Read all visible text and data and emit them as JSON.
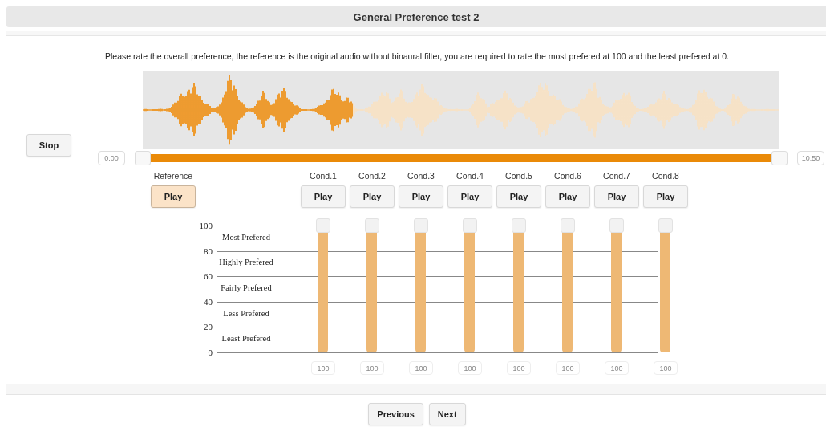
{
  "header": {
    "title": "General Preference test 2"
  },
  "instruction": "Please rate the overall preference, the reference is the original audio without binaural filter, you are required to rate the most prefered at 100 and the least prefered at 0.",
  "stop_button": "Stop",
  "waveform": {
    "level": 0.33
  },
  "range": {
    "start_time": "0.00",
    "end_time": "10.50",
    "start": {
      "level": 0
    },
    "end": {
      "level": 1
    }
  },
  "reference": {
    "label": "Reference",
    "button": "Play",
    "selected": true
  },
  "conditions": [
    {
      "label": "Cond.1",
      "button": "Play",
      "selected": false,
      "level": 1,
      "value": "100"
    },
    {
      "label": "Cond.2",
      "button": "Play",
      "selected": false,
      "level": 1,
      "value": "100"
    },
    {
      "label": "Cond.3",
      "button": "Play",
      "selected": false,
      "level": 1,
      "value": "100"
    },
    {
      "label": "Cond.4",
      "button": "Play",
      "selected": false,
      "level": 1,
      "value": "100"
    },
    {
      "label": "Cond.5",
      "button": "Play",
      "selected": false,
      "level": 1,
      "value": "100"
    },
    {
      "label": "Cond.6",
      "button": "Play",
      "selected": false,
      "level": 1,
      "value": "100"
    },
    {
      "label": "Cond.7",
      "button": "Play",
      "selected": false,
      "level": 1,
      "value": "100"
    },
    {
      "label": "Cond.8",
      "button": "Play",
      "selected": false,
      "level": 1,
      "value": "100"
    }
  ],
  "scale": {
    "ticks": [
      "100",
      "80",
      "60",
      "40",
      "20",
      "0"
    ],
    "bands": [
      "Most Prefered",
      "Highly Prefered",
      "Fairly Prefered",
      "Less Prefered",
      "Least Prefered"
    ]
  },
  "nav": [
    "Previous",
    "Next"
  ]
}
